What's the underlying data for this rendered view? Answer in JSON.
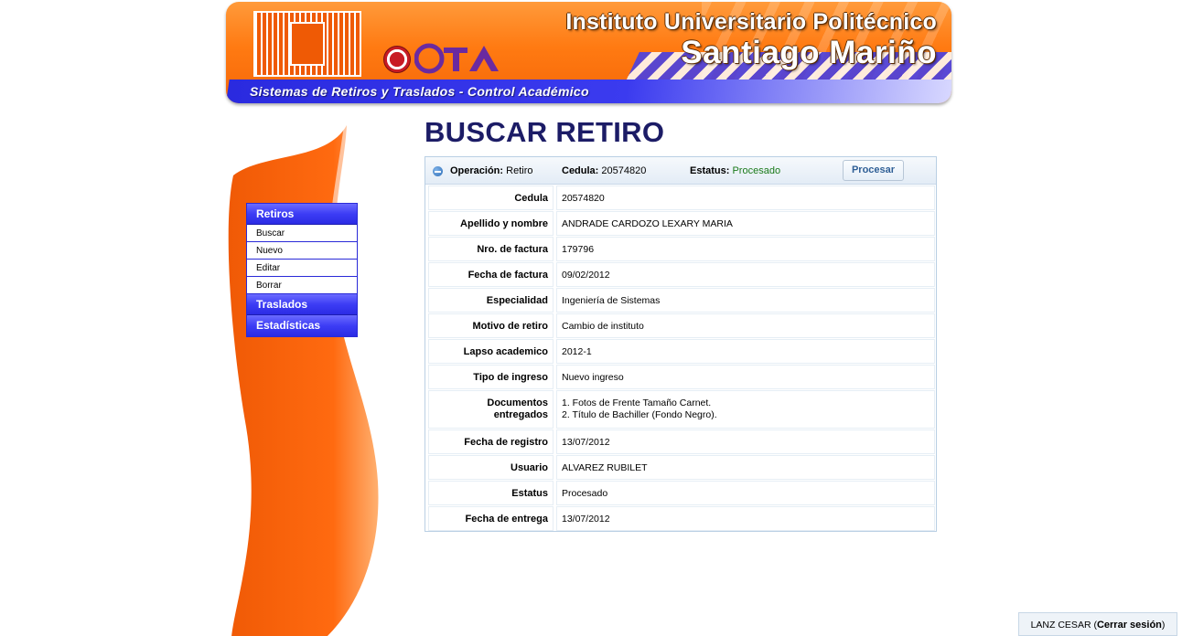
{
  "header": {
    "institution_line1": "Instituto Universitario Politécnico",
    "institution_line2": "Santiago Mariño",
    "system_name": "Sistemas de Retiros y Traslados - Control Académico"
  },
  "menu": {
    "sections": [
      {
        "label": "Retiros",
        "items": [
          "Buscar",
          "Nuevo",
          "Editar",
          "Borrar"
        ]
      },
      {
        "label": "Traslados"
      },
      {
        "label": "Estadísticas"
      }
    ]
  },
  "page_title": "BUSCAR RETIRO",
  "panel": {
    "operation_label": "Operación:",
    "operation_value": "Retiro",
    "cedula_label": "Cedula:",
    "cedula_value": "20574820",
    "status_label": "Estatus:",
    "status_value": "Procesado",
    "status_color": "#1a7a1a",
    "process_button": "Procesar",
    "rows": [
      {
        "label": "Cedula",
        "value": "20574820"
      },
      {
        "label": "Apellido y nombre",
        "value": "ANDRADE CARDOZO LEXARY MARIA"
      },
      {
        "label": "Nro. de factura",
        "value": "179796"
      },
      {
        "label": "Fecha de factura",
        "value": "09/02/2012"
      },
      {
        "label": "Especialidad",
        "value": "Ingeniería de Sistemas"
      },
      {
        "label": "Motivo de retiro",
        "value": "Cambio de instituto"
      },
      {
        "label": "Lapso academico",
        "value": "2012-1"
      },
      {
        "label": "Tipo de ingreso",
        "value": "Nuevo ingreso"
      },
      {
        "label_lines": [
          "Documentos",
          "entregados"
        ],
        "value_lines": [
          "1. Fotos de Frente Tamaño Carnet.",
          "2. Título de Bachiller (Fondo Negro)."
        ]
      },
      {
        "label": "Fecha de registro",
        "value": "13/07/2012"
      },
      {
        "label": "Usuario",
        "value": "ALVAREZ RUBILET"
      },
      {
        "label": "Estatus",
        "value": "Procesado"
      },
      {
        "label": "Fecha de entrega",
        "value": "13/07/2012"
      }
    ]
  },
  "session": {
    "user": "LANZ CESAR",
    "open_paren": "(",
    "logout": "Cerrar sesión",
    "close_paren": ")"
  },
  "colors": {
    "banner_orange": "#ff7a12",
    "menu_blue": "#3d3df5",
    "title_navy": "#1c1c66",
    "panel_border": "#b9cfe4"
  }
}
